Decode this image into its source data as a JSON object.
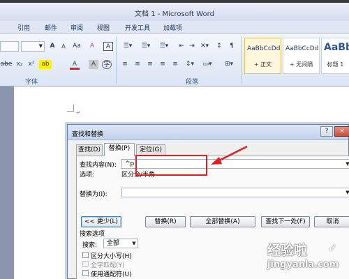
{
  "window": {
    "title": "文档 1 - Microsoft Word"
  },
  "tabs": [
    "引用",
    "邮件",
    "审阅",
    "视图",
    "开发工具",
    "加载项"
  ],
  "ribbon": {
    "groups": {
      "font": "字体",
      "paragraph": "段落"
    },
    "styles": [
      {
        "sample": "AaBbCcDd",
        "name": "+ 正文"
      },
      {
        "sample": "AaBbCcDd",
        "name": "+ 无间隔"
      },
      {
        "sample": "AaBb",
        "name": "标题 1"
      }
    ],
    "font_buttons": {
      "grow": "A",
      "shrink": "A",
      "clear": "A",
      "phonetic": "A",
      "border": "A",
      "strike": "abe",
      "sub": "x₂",
      "sup": "x²",
      "change_case": "Aa",
      "highlight": "ab",
      "color": "A",
      "shade": "A",
      "enclose": "字"
    }
  },
  "dialog": {
    "title": "查找和替换",
    "help": "?",
    "close": "×",
    "tabs": [
      "查找(D)",
      "替换(P)",
      "定位(G)"
    ],
    "find_label": "查找内容(N):",
    "find_value": "^p",
    "options_label": "选项:",
    "options_value": "区分全/半角",
    "replace_label": "替换为(I):",
    "replace_value": "",
    "buttons": {
      "less": "<< 更少(L)",
      "replace": "替换(R)",
      "replace_all": "全部替换(A)",
      "find_next": "查找下一处(F)",
      "cancel": "取消"
    },
    "search_options_title": "搜索选项",
    "search_label": "搜索:",
    "search_value": "全部",
    "checkboxes": [
      {
        "label": "区分大小写(H)",
        "enabled": true
      },
      {
        "label": "全字匹配(Y)",
        "enabled": false
      },
      {
        "label": "使用通配符(U)",
        "enabled": true
      }
    ]
  },
  "watermark": {
    "cn": "经验啦",
    "check": "✓",
    "url": "jingyanla.com"
  },
  "colors": {
    "highlight": "#e01e1e",
    "ribbon": "#dbe5f5",
    "title": "#d6dcef"
  }
}
